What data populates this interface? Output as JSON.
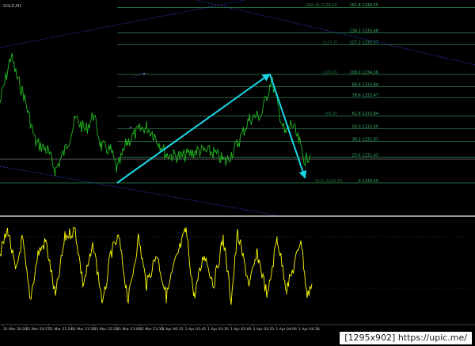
{
  "platform": {
    "top_left_label": "GOLD,M1",
    "watermark": "[1295x902] https://upic.me/"
  },
  "colors": {
    "background": "#000000",
    "price_line": "#1fb81f",
    "oscillator_line": "#ffff00",
    "fib_level": "#2e8b57",
    "fib_label": "#3cb371",
    "zigzag": "#19d6e6",
    "channel": "#3a3ad8",
    "separator": "#cfcfcf",
    "grid_dotted": "#4a4a4a",
    "axis_text": "#d0d0d0"
  },
  "fib_levels": [
    {
      "ratio": "161.8",
      "price": "1236.55",
      "left_tag": "(161.8)  1236.55"
    },
    {
      "ratio": "138.2",
      "price": "1235.68",
      "left_tag": ""
    },
    {
      "ratio": "127.2",
      "price": "1235.27",
      "left_tag": "(127.2)"
    },
    {
      "ratio": "100.0",
      "price": "1234.26",
      "left_tag": "(100.0)"
    },
    {
      "ratio": "88.6",
      "price": "1233.84",
      "left_tag": ""
    },
    {
      "ratio": "78.6",
      "price": "1233.47",
      "left_tag": ""
    },
    {
      "ratio": "61.8",
      "price": "1232.84",
      "left_tag": "(61.8)"
    },
    {
      "ratio": "50.0",
      "price": "1232.40",
      "left_tag": ""
    },
    {
      "ratio": "38.2",
      "price": "1231.97",
      "left_tag": ""
    },
    {
      "ratio": "23.6",
      "price": "1231.43",
      "left_tag": ""
    },
    {
      "ratio": "0",
      "price": "1230.55",
      "left_tag": "(0.0)  1230.55"
    }
  ],
  "time_axis": [
    "31 Mar 20:20",
    "31 Mar 20:57",
    "31 Mar 21:24",
    "31 Mar 21:56",
    "31 Mar 22:28",
    "31 Mar 23:00",
    "31 Mar 23:30",
    "1 Apr 00:15",
    "1 Apr 01:45",
    "1 Apr 02:16",
    "1 Apr 03:00",
    "1 Apr 03:33",
    "1 Apr 04:06",
    "1 Apr 04:38"
  ]
}
